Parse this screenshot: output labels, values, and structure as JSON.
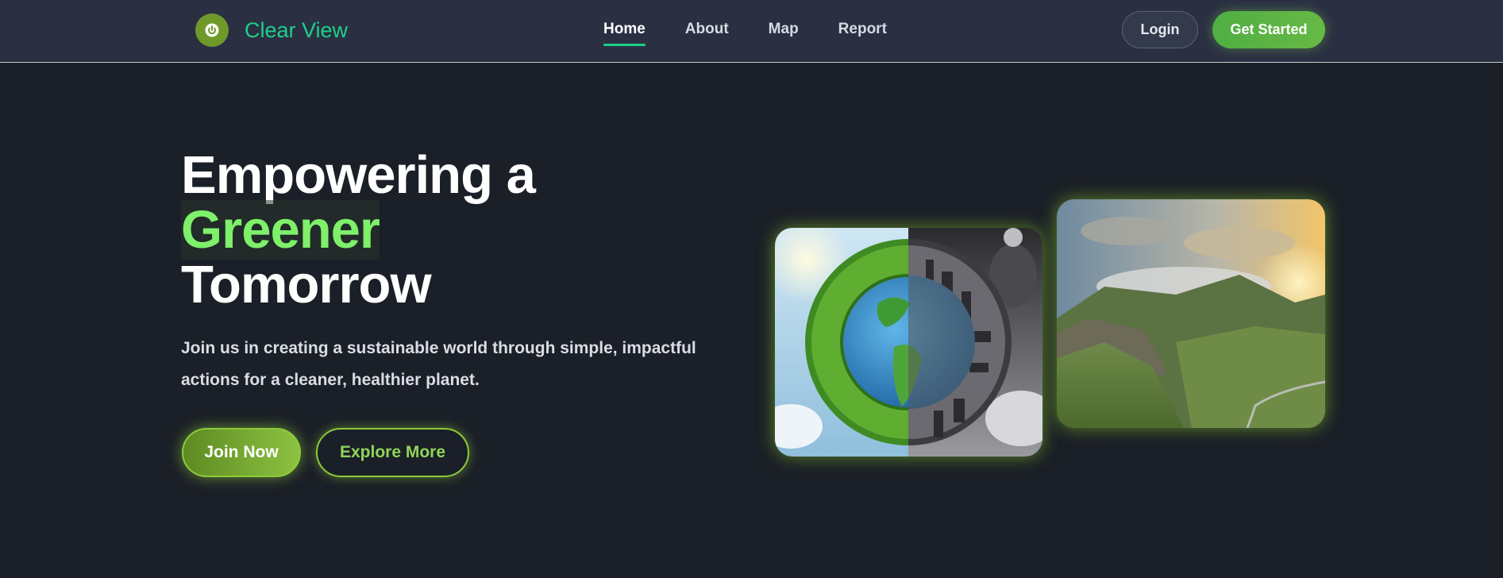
{
  "brand": {
    "name": "Clear View",
    "logo_icon": "power-icon"
  },
  "nav": {
    "links": [
      {
        "label": "Home",
        "active": true
      },
      {
        "label": "About",
        "active": false
      },
      {
        "label": "Map",
        "active": false
      },
      {
        "label": "Report",
        "active": false
      }
    ],
    "login_label": "Login",
    "get_started_label": "Get Started"
  },
  "hero": {
    "title_line1": "Empowering a",
    "title_highlight": "Greener",
    "title_line3": "Tomorrow",
    "subtitle": "Join us in creating a sustainable world through simple, impactful actions for a cleaner, healthier planet.",
    "join_label": "Join Now",
    "explore_label": "Explore More"
  },
  "images": {
    "earth": "earth-half-forest-half-city-image",
    "valley": "green-mountain-valley-image"
  },
  "colors": {
    "background": "#1b1f27",
    "navbar": "#2a3042",
    "accent_green": "#7ef06a",
    "brand_teal": "#1fcf8a",
    "button_green": "#68b944"
  }
}
